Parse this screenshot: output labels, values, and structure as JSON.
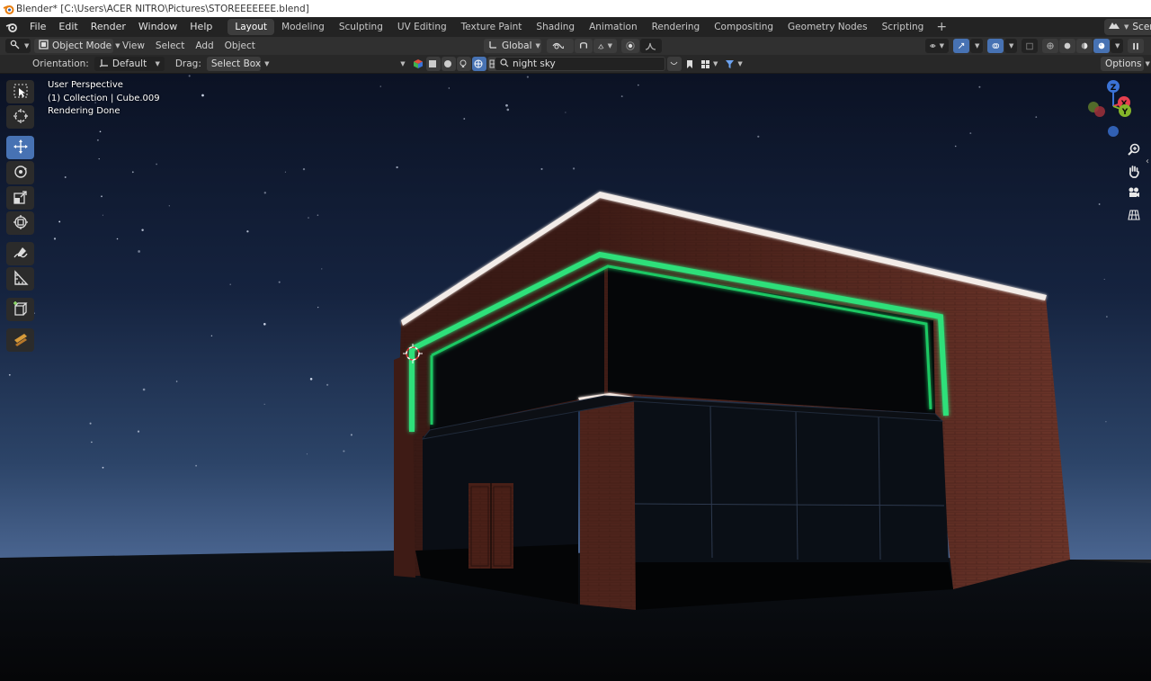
{
  "window": {
    "title": "Blender* [C:\\Users\\ACER NITRO\\Pictures\\STOREEEEEEE.blend]"
  },
  "menu": {
    "items": [
      "File",
      "Edit",
      "Render",
      "Window",
      "Help"
    ]
  },
  "workspaces": {
    "tabs": [
      "Layout",
      "Modeling",
      "Sculpting",
      "UV Editing",
      "Texture Paint",
      "Shading",
      "Animation",
      "Rendering",
      "Compositing",
      "Geometry Nodes",
      "Scripting"
    ],
    "active": "Layout",
    "add_icon": "plus-icon"
  },
  "scene": {
    "label": "Scen"
  },
  "header": {
    "mode": "Object Mode",
    "view": "View",
    "select": "Select",
    "add": "Add",
    "object": "Object",
    "transform_orientation": "Global"
  },
  "tool_settings": {
    "orientation_label": "Orientation:",
    "orientation_value": "Default",
    "drag_label": "Drag:",
    "drag_value": "Select Box",
    "search_value": "night sky",
    "options": "Options"
  },
  "viewport": {
    "perspective": "User Perspective",
    "collection": "(1) Collection | Cube.009",
    "status": "Rendering Done"
  },
  "gizmo": {
    "z": "Z",
    "x": "X",
    "y": "Y",
    "colors": {
      "x": "#e6404f",
      "y": "#84b52a",
      "z": "#3b73d6"
    }
  },
  "toolbar": {
    "tools": [
      "select-box-tool",
      "cursor-tool",
      "move-tool",
      "rotate-tool",
      "scale-tool",
      "transform-tool",
      "annotate-tool",
      "measure-tool",
      "add-cube-tool",
      "wood-texture-tool"
    ],
    "active": "move-tool"
  },
  "colors": {
    "neon": "#2fe07a",
    "brick": "#5a2a22",
    "sky_top": "#0a1223",
    "sky_horizon": "#3f5b86",
    "accent": "#4772b3"
  }
}
